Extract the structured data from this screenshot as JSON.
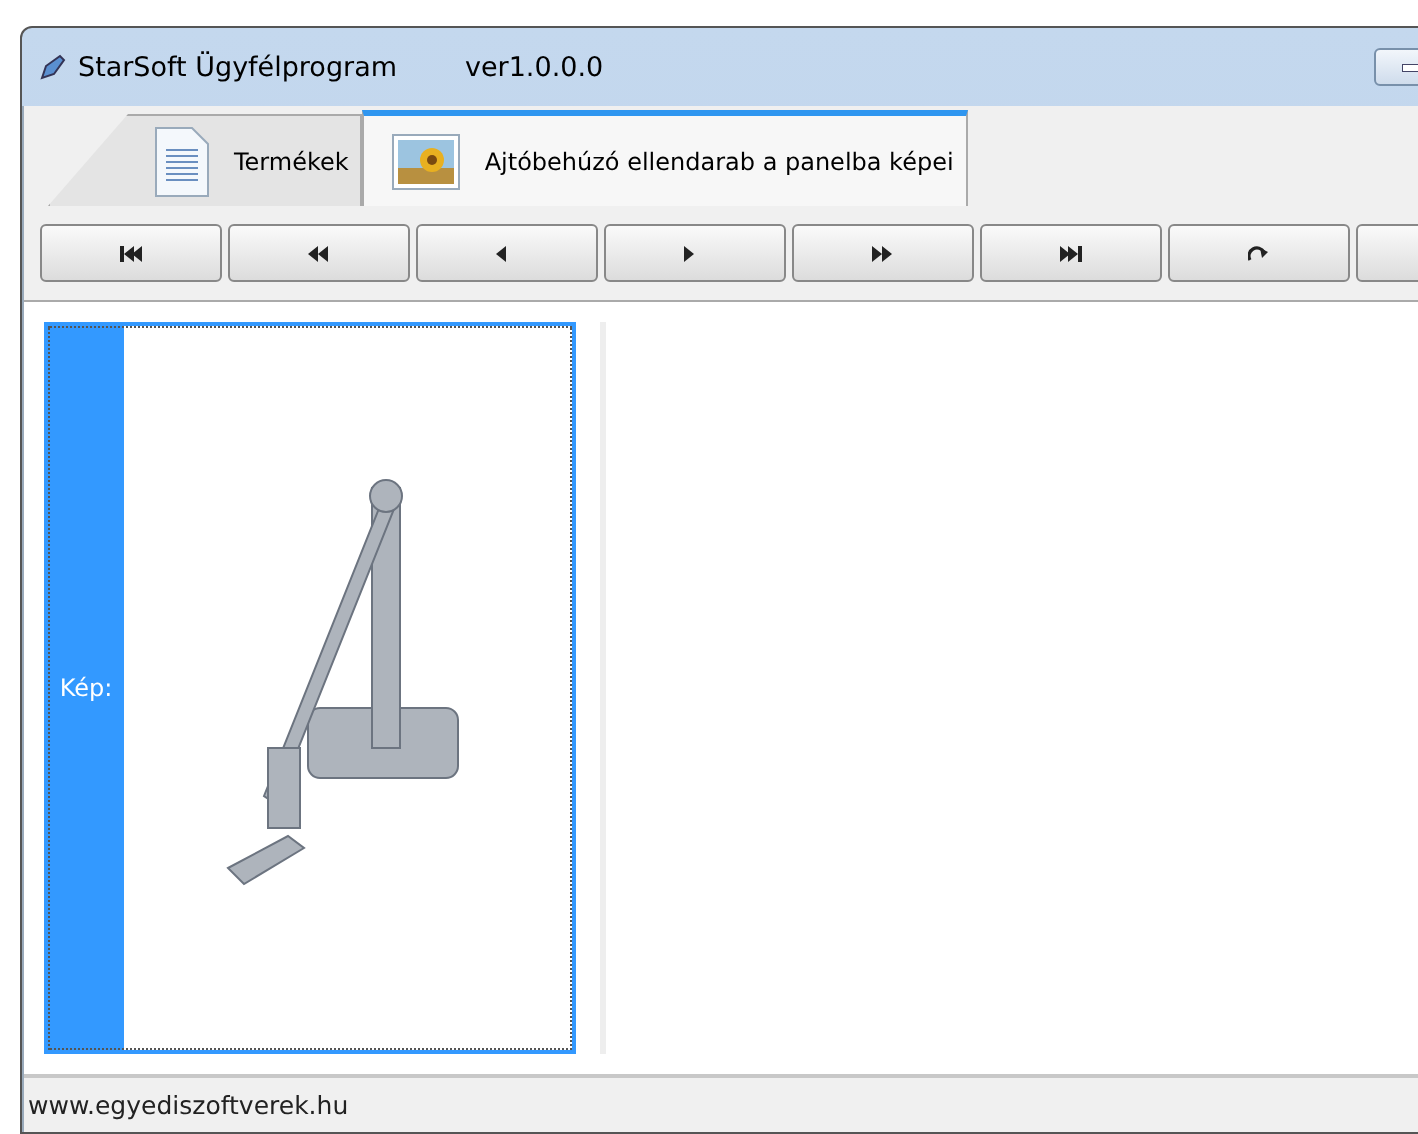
{
  "window": {
    "title": "StarSoft Ügyfélprogram",
    "version": "ver1.0.0.0"
  },
  "tabs": [
    {
      "label": "Termékek",
      "kind": "document",
      "selected": false
    },
    {
      "label": "Ajtóbehúzó ellendarab a panelba képei",
      "kind": "picture",
      "selected": true
    }
  ],
  "toolbar": [
    {
      "kind": "first"
    },
    {
      "kind": "rewind"
    },
    {
      "kind": "previous"
    },
    {
      "kind": "next"
    },
    {
      "kind": "forward"
    },
    {
      "kind": "last"
    },
    {
      "kind": "refresh"
    },
    {
      "kind": "other"
    }
  ],
  "picture_card": {
    "label": "Kép:",
    "selected": true
  },
  "status_bar": {
    "text": "www.egyediszoftverek.hu"
  }
}
